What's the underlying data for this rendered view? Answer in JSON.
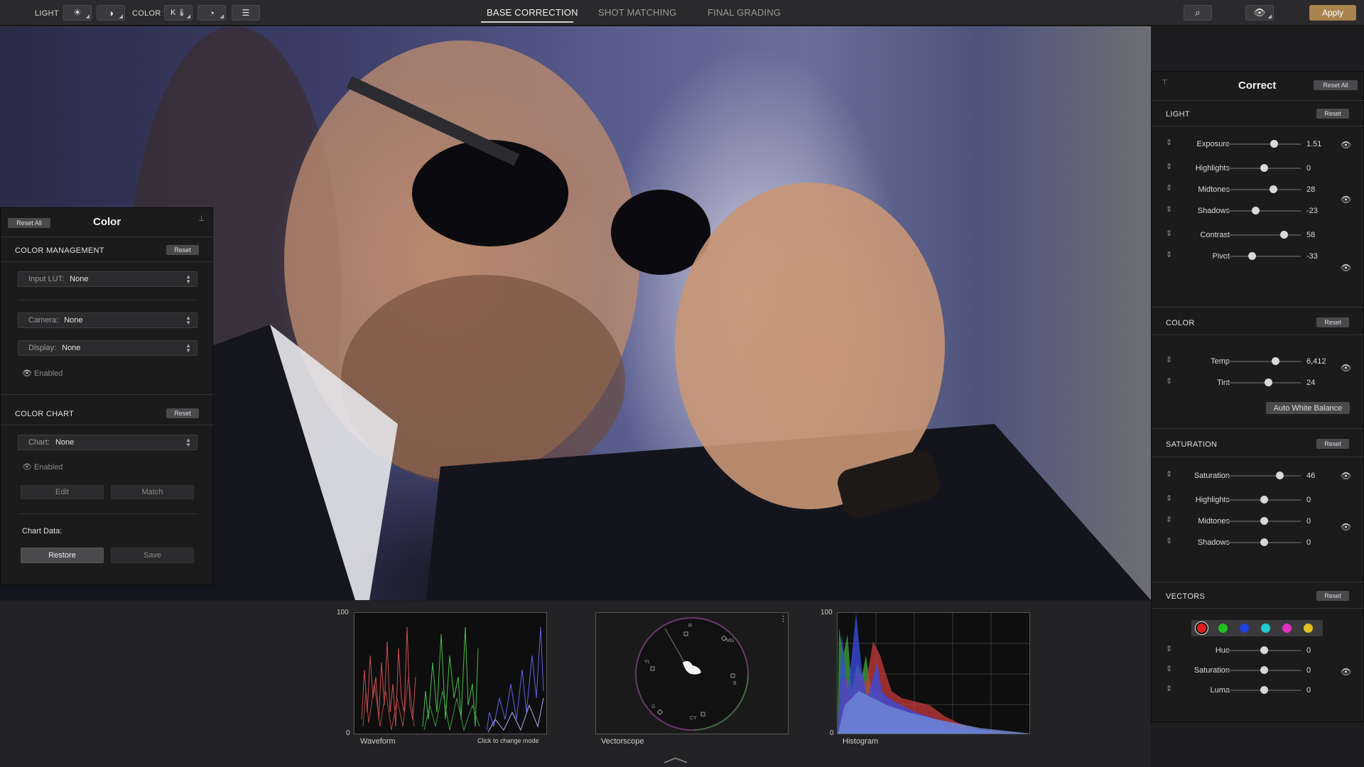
{
  "topbar": {
    "light_label": "LIGHT",
    "color_label": "COLOR",
    "k_label": "K",
    "tabs": [
      "BASE CORRECTION",
      "SHOT MATCHING",
      "FINAL GRADING"
    ],
    "apply_label": "Apply"
  },
  "color_panel": {
    "reset_all": "Reset All",
    "title": "Color",
    "color_management": {
      "header": "COLOR MANAGEMENT",
      "reset": "Reset",
      "input_lut": {
        "label": "Input LUT:",
        "value": "None"
      },
      "camera": {
        "label": "Camera:",
        "value": "None"
      },
      "display": {
        "label": "Display:",
        "value": "None"
      },
      "enabled": "Enabled"
    },
    "color_chart": {
      "header": "COLOR CHART",
      "reset": "Reset",
      "chart": {
        "label": "Chart:",
        "value": "None"
      },
      "enabled": "Enabled",
      "edit": "Edit",
      "match": "Match",
      "chart_data": "Chart Data:",
      "restore": "Restore",
      "save": "Save"
    }
  },
  "correct_panel": {
    "title": "Correct",
    "reset_all": "Reset All",
    "light": {
      "header": "LIGHT",
      "reset": "Reset",
      "rows": [
        {
          "label": "Exposure",
          "value": "1.51",
          "pos": 0.64
        },
        {
          "label": "Highlights",
          "value": "0",
          "pos": 0.5
        },
        {
          "label": "Midtones",
          "value": "28",
          "pos": 0.63
        },
        {
          "label": "Shadows",
          "value": "-23",
          "pos": 0.39
        },
        {
          "label": "Contrast",
          "value": "58",
          "pos": 0.77
        },
        {
          "label": "Pivot",
          "value": "-33",
          "pos": 0.34
        }
      ]
    },
    "color": {
      "header": "COLOR",
      "reset": "Reset",
      "rows": [
        {
          "label": "Temp",
          "value": "6,412",
          "pos": 0.66
        },
        {
          "label": "Tint",
          "value": "24",
          "pos": 0.56
        }
      ],
      "auto_white_balance": "Auto White Balance"
    },
    "saturation": {
      "header": "SATURATION",
      "reset": "Reset",
      "rows": [
        {
          "label": "Saturation",
          "value": "46",
          "pos": 0.71
        },
        {
          "label": "Highlights",
          "value": "0",
          "pos": 0.5
        },
        {
          "label": "Midtones",
          "value": "0",
          "pos": 0.5
        },
        {
          "label": "Shadows",
          "value": "0",
          "pos": 0.5
        }
      ]
    },
    "vectors": {
      "header": "VECTORS",
      "reset": "Reset",
      "swatches": [
        "#e02020",
        "#20c020",
        "#2040e0",
        "#20c8d0",
        "#e030c0",
        "#e0c020"
      ],
      "rows": [
        {
          "label": "Hue",
          "value": "0",
          "pos": 0.5
        },
        {
          "label": "Saturation",
          "value": "0",
          "pos": 0.5
        },
        {
          "label": "Luma",
          "value": "0",
          "pos": 0.5
        }
      ]
    }
  },
  "scopes": {
    "waveform": {
      "label": "Waveform",
      "hint": "Click to change mode",
      "max": "100",
      "min": "0"
    },
    "vectorscope": {
      "label": "Vectorscope",
      "targets": [
        "R",
        "MG",
        "B",
        "CY",
        "G",
        "YL"
      ]
    },
    "histogram": {
      "label": "Histogram",
      "max": "100",
      "min": "0"
    }
  }
}
